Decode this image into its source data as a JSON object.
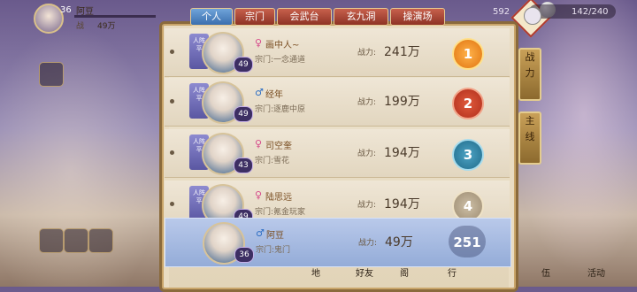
{
  "player": {
    "level": "36",
    "name": "阿豆",
    "power_label": "战",
    "power_value": "49万"
  },
  "resources": {
    "gem": "592",
    "stamina": "142/240"
  },
  "tabs": {
    "personal": "个人",
    "sect": "宗门",
    "arena": "会武台",
    "cave": "玄九洞",
    "drill": "操演场"
  },
  "side_tabs": {
    "combat": [
      "战",
      "力"
    ],
    "mainline": [
      "主",
      "线"
    ]
  },
  "labels": {
    "power": "战力:",
    "sect_prefix": "宗门:",
    "rank_tag": "人阵平"
  },
  "rows": [
    {
      "gender": "♀",
      "gender_color": "#d64a8a",
      "name": "画中人~",
      "sect": "一念通道",
      "power": "241万",
      "level": "49",
      "rank": "1"
    },
    {
      "gender": "♂",
      "gender_color": "#2f6fc4",
      "name": "经年",
      "sect": "逐鹿中原",
      "power": "199万",
      "level": "49",
      "rank": "2"
    },
    {
      "gender": "♀",
      "gender_color": "#d64a8a",
      "name": "司空奎",
      "sect": "雪花",
      "power": "194万",
      "level": "43",
      "rank": "3"
    },
    {
      "gender": "♀",
      "gender_color": "#d64a8a",
      "name": "陆思远",
      "sect": "氪金玩家",
      "power": "194万",
      "level": "49",
      "rank": "4"
    }
  ],
  "self_row": {
    "gender": "♂",
    "gender_color": "#2f6fc4",
    "name": "阿豆",
    "sect": "鬼门",
    "power": "49万",
    "level": "36",
    "rank": "251"
  },
  "bottom": [
    "地",
    "好友",
    "阁",
    "行",
    "伍",
    "活动"
  ]
}
